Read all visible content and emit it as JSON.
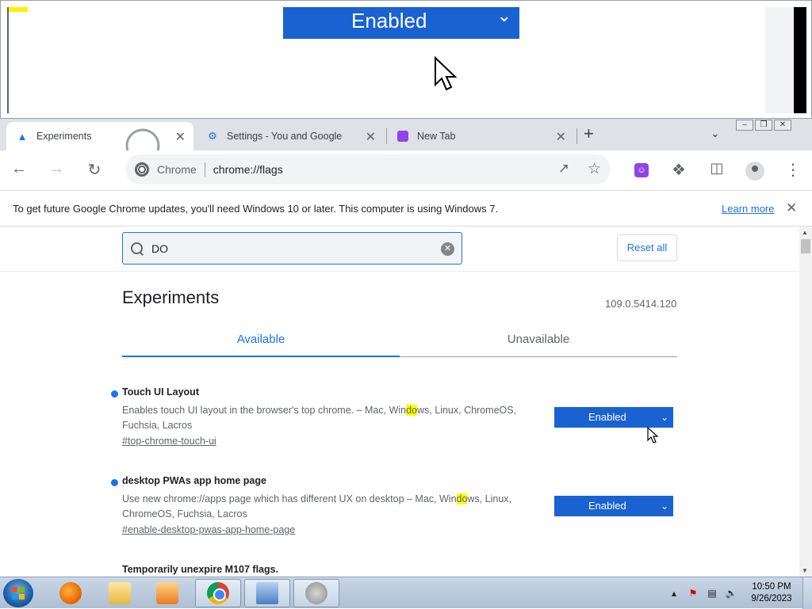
{
  "magnifier": {
    "select_value": "Enabled"
  },
  "tabs": [
    {
      "title": "Experiments",
      "icon": "flask-icon",
      "active": true
    },
    {
      "title": "Settings - You and Google",
      "icon": "gear-icon",
      "active": false
    },
    {
      "title": "New Tab",
      "icon": "face-icon",
      "active": false
    }
  ],
  "omnibox": {
    "site_label": "Chrome",
    "url": "chrome://flags"
  },
  "infobar": {
    "message": "To get future Google Chrome updates, you'll need Windows 10 or later. This computer is using Windows 7.",
    "link": "Learn more"
  },
  "search": {
    "query": "DO"
  },
  "reset_all": "Reset all",
  "page": {
    "title": "Experiments",
    "version": "109.0.5414.120",
    "tab_available": "Available",
    "tab_unavailable": "Unavailable"
  },
  "flags": [
    {
      "name": "Touch UI Layout",
      "desc_before": "Enables touch UI layout in the browser's top chrome. – Mac, Win",
      "highlight": "do",
      "desc_after": "ws, Linux, ChromeOS, Fuchsia, Lacros",
      "link": "#top-chrome-touch-ui",
      "value": "Enabled"
    },
    {
      "name": "desktop PWAs app home page",
      "desc_before": "Use new chrome://apps page which has different UX on desktop – Mac, Win",
      "highlight": "do",
      "desc_after": "ws, Linux, ChromeOS, Fuchsia, Lacros",
      "link": "#enable-desktop-pwas-app-home-page",
      "value": "Enabled"
    },
    {
      "name": "Temporarily unexpire M107 flags."
    }
  ],
  "taskbar": {
    "apps": [
      "firefox",
      "explorer",
      "media-player",
      "chrome",
      "ruler",
      "speaker"
    ],
    "time": "10:50 PM",
    "date": "9/26/2023"
  }
}
